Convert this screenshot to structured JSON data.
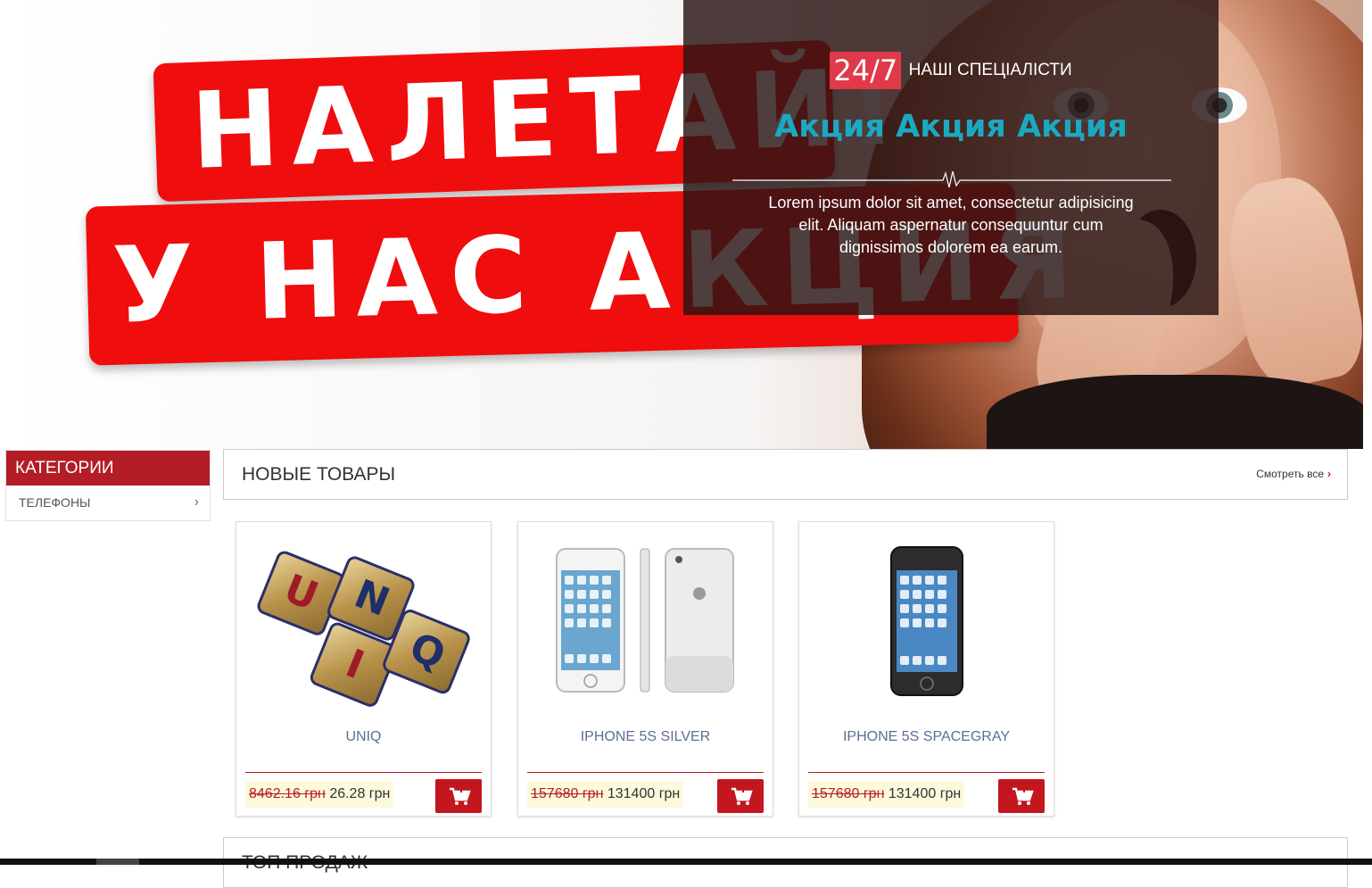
{
  "hero": {
    "banner_line1": "НАЛЕТАЙ!",
    "banner_line2": "У НАС АКЦИЯ",
    "badge": "24/7",
    "specialists": "НАШІ СПЕЦІАЛІСТИ",
    "headline": "Акция Акция Акция",
    "text": "Lorem ipsum dolor sit amet, consectetur adipisicing elit. Aliquam aspernatur consequuntur cum dignissimos dolorem ea earum."
  },
  "sidebar": {
    "title": "КАТЕГОРИИ",
    "items": [
      {
        "label": "ТЕЛЕФОНЫ",
        "icon": "chevron-right-icon"
      }
    ]
  },
  "new_products": {
    "title": "НОВЫЕ ТОВАРЫ",
    "see_all": "Смотреть все",
    "products": [
      {
        "name": "UNIQ",
        "old_price": "8462.16 грн",
        "new_price": "26.28 грн"
      },
      {
        "name": "IPHONE 5S SILVER",
        "old_price": "157680 грн",
        "new_price": "131400 грн"
      },
      {
        "name": "IPHONE 5S SPACEGRAY",
        "old_price": "157680 грн",
        "new_price": "131400 грн"
      }
    ]
  },
  "top_sales": {
    "title": "ТОП ПРОДАЖ"
  },
  "colors": {
    "accent": "#b31d26",
    "cart": "#c4161e",
    "headline": "#1ba9c1",
    "badge": "#e0394a"
  }
}
